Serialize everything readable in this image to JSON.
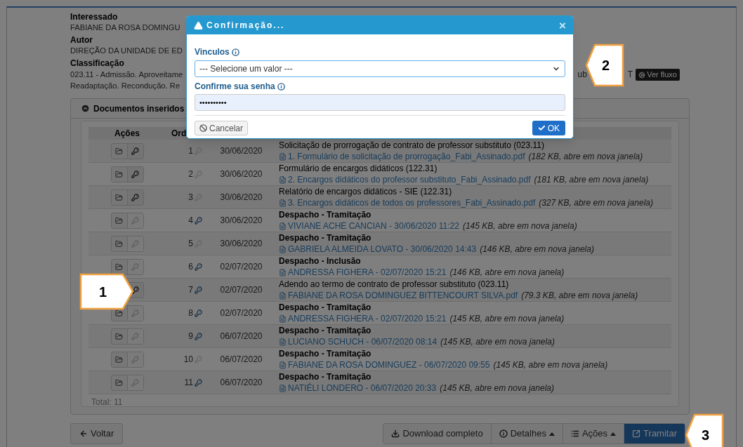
{
  "fields": [
    {
      "label": "Interessado",
      "lines": [
        "FABIANE DA ROSA DOMINGU"
      ]
    },
    {
      "label": "Autor",
      "lines": [
        "DIREÇÃO DA UNIDADE DE ED"
      ]
    },
    {
      "label": "Classificação",
      "lines": [
        "023.11 - Admissão. Aproveitame",
        "Readaptação. Recondução. Re"
      ],
      "fragments": [
        "ub",
        "T"
      ],
      "flow_button": "Ver fluxo"
    }
  ],
  "panel": {
    "title": "Documentos inseridos",
    "columns": [
      "Ações",
      "Ord"
    ],
    "total": "Total: 11",
    "rows": [
      {
        "kind": "document",
        "key_enabled": true,
        "order": "1",
        "order_key_active": false,
        "date": "30/06/2020",
        "title": "Solicitação de prorrogação de contrato de professor substituto (023.11)",
        "link": "1. Formulário de solicitação de prorrogação_Fabi_Assinado.pdf",
        "size": "(182 KB, abre em nova janela)"
      },
      {
        "kind": "document",
        "key_enabled": true,
        "order": "2",
        "order_key_active": false,
        "date": "30/06/2020",
        "title": "Formulário de encargos didáticos (122.31)",
        "link": "2. Encargos didáticos do professor substituto_Fabi_Assinado.pdf",
        "size": "(181 KB, abre em nova janela)"
      },
      {
        "kind": "document",
        "key_enabled": true,
        "order": "3",
        "order_key_active": false,
        "date": "30/06/2020",
        "title": "Relatório de encargos didáticos - SIE (122.31)",
        "link": "3. Encargos didáticos de todos os professores_Fabi_Assinado.pdf",
        "size": "(327 KB, abre em nova janela)"
      },
      {
        "kind": "despacho",
        "key_enabled": false,
        "order": "4",
        "order_key_active": true,
        "date": "30/06/2020",
        "title": "Despacho - Tramitação",
        "link": "VIVIANE ACHE CANCIAN - 30/06/2020 11:22",
        "size": "(145 KB, abre em nova janela)"
      },
      {
        "kind": "despacho",
        "key_enabled": false,
        "order": "5",
        "order_key_active": false,
        "date": "30/06/2020",
        "title": "Despacho - Tramitação",
        "link": "GABRIELA ALMEIDA LOVATO - 30/06/2020 14:43",
        "size": "(146 KB, abre em nova janela)"
      },
      {
        "kind": "despacho",
        "key_enabled": false,
        "order": "6",
        "order_key_active": true,
        "date": "02/07/2020",
        "title": "Despacho - Inclusão",
        "link": "ANDRESSA FIGHERA - 02/07/2020 15:21",
        "size": "(146 KB, abre em nova janela)"
      },
      {
        "kind": "document",
        "key_enabled": true,
        "order": "7",
        "order_key_active": true,
        "date": "02/07/2020",
        "title": "Adendo ao termo de contrato de professor substituto (023.11)",
        "link": "FABIANE DA ROSA DOMINGUEZ BITTENCOURT SILVA.pdf",
        "size": "(79.3 KB, abre em nova janela)"
      },
      {
        "kind": "despacho",
        "key_enabled": false,
        "order": "8",
        "order_key_active": true,
        "date": "02/07/2020",
        "title": "Despacho - Tramitação",
        "link": "ANDRESSA FIGHERA - 02/07/2020 15:21",
        "size": "(145 KB, abre em nova janela)"
      },
      {
        "kind": "despacho",
        "key_enabled": false,
        "order": "9",
        "order_key_active": true,
        "date": "06/07/2020",
        "title": "Despacho - Tramitação",
        "link": "LUCIANO SCHUCH - 06/07/2020 08:14",
        "size": "(145 KB, abre em nova janela)"
      },
      {
        "kind": "despacho",
        "key_enabled": false,
        "order": "10",
        "order_key_active": false,
        "date": "06/07/2020",
        "title": "Despacho - Tramitação",
        "link": "FABIANE DA ROSA DOMINGUEZ - 06/07/2020 09:55",
        "size": "(145 KB, abre em nova janela)"
      },
      {
        "kind": "despacho",
        "key_enabled": false,
        "order": "11",
        "order_key_active": true,
        "date": "06/07/2020",
        "title": "Despacho - Tramitação",
        "link": "NATIÉLI LONDERO - 06/07/2020 20:33",
        "size": "(145 KB, abre em nova janela)"
      }
    ]
  },
  "footer": {
    "back": "Voltar",
    "group": [
      {
        "kind": "download",
        "label": "Download completo"
      },
      {
        "kind": "details",
        "label": "Detalhes"
      },
      {
        "kind": "actions",
        "label": "Ações"
      },
      {
        "kind": "send",
        "label": "Tramitar"
      }
    ]
  },
  "modal": {
    "title": "Confirmação...",
    "close": "×",
    "select_label": "Vinculos",
    "select_value": "--- Selecione um valor ---",
    "password_label": "Confirme sua senha",
    "password_value": "••••••••••",
    "cancel": "Cancelar",
    "ok": "OK"
  },
  "callouts": [
    {
      "number": "1"
    },
    {
      "number": "2"
    },
    {
      "number": "3"
    }
  ]
}
